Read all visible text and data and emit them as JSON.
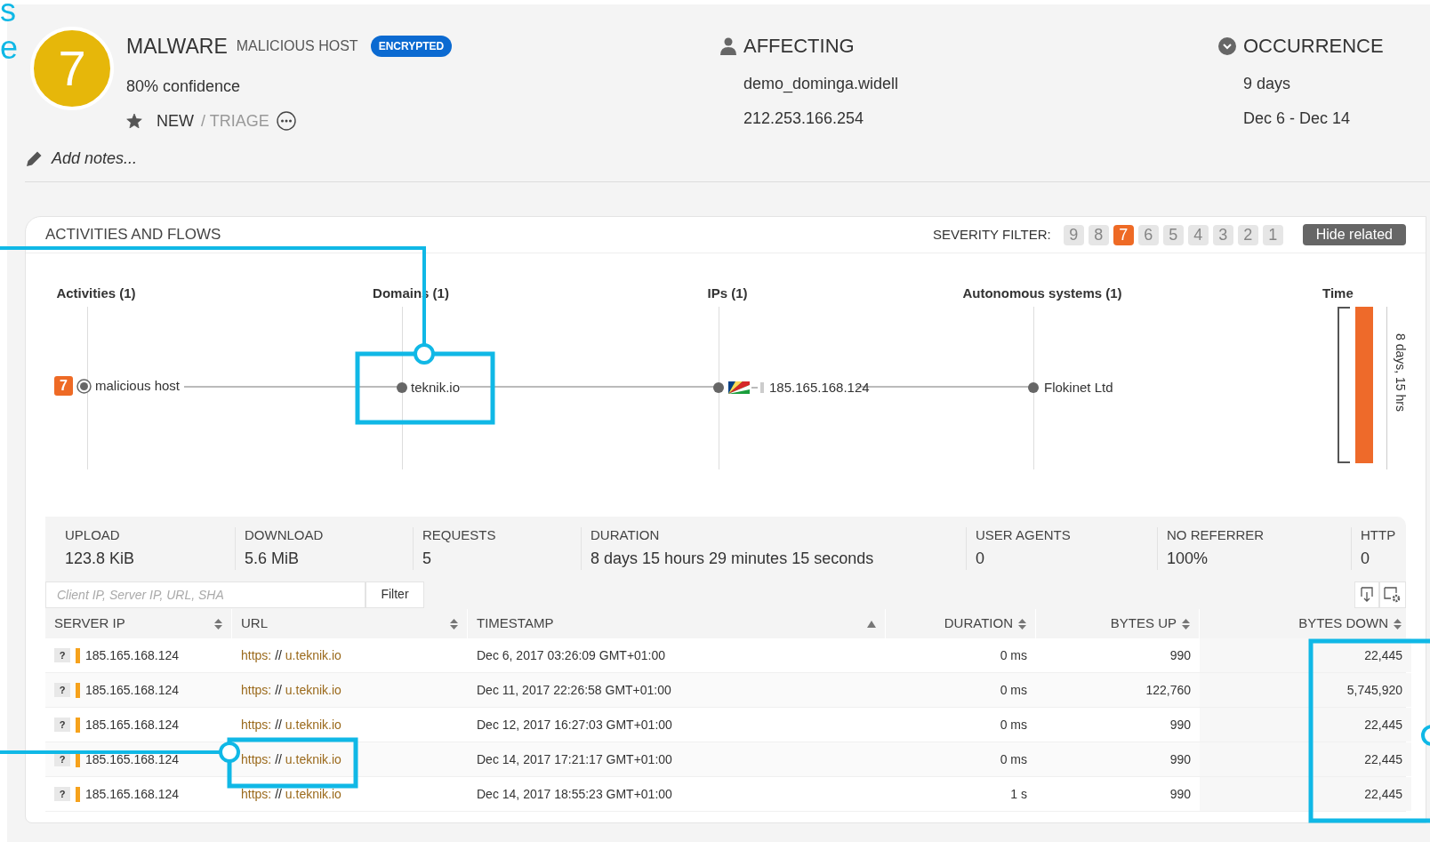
{
  "annotation_fragments": [
    "s",
    "e"
  ],
  "alert": {
    "severity": "7",
    "category": "MALWARE",
    "type": "MALICIOUS HOST",
    "tag": "ENCRYPTED",
    "confidence": "80% confidence",
    "status": "NEW",
    "status_next": "/ TRIAGE",
    "starred": true
  },
  "affecting": {
    "title": "AFFECTING",
    "user": "demo_dominga.widell",
    "ip": "212.253.166.254"
  },
  "occurrence": {
    "title": "OCCURRENCE",
    "duration": "9 days",
    "range": "Dec 6 - Dec 14"
  },
  "notes": {
    "placeholder": "Add notes..."
  },
  "panel": {
    "title": "ACTIVITIES AND FLOWS",
    "severity_filter_label": "SEVERITY FILTER:",
    "severity_levels": [
      {
        "label": "9",
        "selected": false
      },
      {
        "label": "8",
        "selected": false
      },
      {
        "label": "7",
        "selected": true
      },
      {
        "label": "6",
        "selected": false
      },
      {
        "label": "5",
        "selected": false
      },
      {
        "label": "4",
        "selected": false
      },
      {
        "label": "3",
        "selected": false
      },
      {
        "label": "2",
        "selected": false
      },
      {
        "label": "1",
        "selected": false
      }
    ],
    "hide_button": "Hide related",
    "graph": {
      "columns": [
        "Activities (1)",
        "Domains (1)",
        "IPs (1)",
        "Autonomous systems (1)",
        "Time"
      ],
      "activity": {
        "severity": "7",
        "name": "malicious host"
      },
      "domain": "teknik.io",
      "ip": "185.165.168.124",
      "asn": "Flokinet Ltd",
      "time_span": "8 days, 15 hrs"
    },
    "stats": [
      {
        "label": "UPLOAD",
        "value": "123.8 KiB"
      },
      {
        "label": "DOWNLOAD",
        "value": "5.6 MiB"
      },
      {
        "label": "REQUESTS",
        "value": "5"
      },
      {
        "label": "DURATION",
        "value": "8 days 15 hours 29 minutes 15 seconds"
      },
      {
        "label": "USER AGENTS",
        "value": "0"
      },
      {
        "label": "NO REFERRER",
        "value": "100%"
      },
      {
        "label": "HTTP",
        "value": "0"
      }
    ],
    "filter": {
      "placeholder": "Client IP, Server IP, URL, SHA",
      "button": "Filter"
    },
    "table": {
      "columns": [
        {
          "label": "SERVER IP",
          "sorted": false
        },
        {
          "label": "URL",
          "sorted": false
        },
        {
          "label": "TIMESTAMP",
          "sorted": true
        },
        {
          "label": "DURATION",
          "sorted": false
        },
        {
          "label": "BYTES UP",
          "sorted": false
        },
        {
          "label": "BYTES DOWN",
          "sorted": false
        }
      ],
      "rows": [
        {
          "badge": "?",
          "server_ip": "185.165.168.124",
          "url": {
            "scheme": "https:",
            "sep": "//",
            "host": "u.teknik.io"
          },
          "timestamp": "Dec 6, 2017 03:26:09 GMT+01:00",
          "duration": "0 ms",
          "bytes_up": "990",
          "bytes_down": "22,445"
        },
        {
          "badge": "?",
          "server_ip": "185.165.168.124",
          "url": {
            "scheme": "https:",
            "sep": "//",
            "host": "u.teknik.io"
          },
          "timestamp": "Dec 11, 2017 22:26:58 GMT+01:00",
          "duration": "0 ms",
          "bytes_up": "122,760",
          "bytes_down": "5,745,920"
        },
        {
          "badge": "?",
          "server_ip": "185.165.168.124",
          "url": {
            "scheme": "https:",
            "sep": "//",
            "host": "u.teknik.io"
          },
          "timestamp": "Dec 12, 2017 16:27:03 GMT+01:00",
          "duration": "0 ms",
          "bytes_up": "990",
          "bytes_down": "22,445"
        },
        {
          "badge": "?",
          "server_ip": "185.165.168.124",
          "url": {
            "scheme": "https:",
            "sep": "//",
            "host": "u.teknik.io"
          },
          "timestamp": "Dec 14, 2017 17:21:17 GMT+01:00",
          "duration": "0 ms",
          "bytes_up": "990",
          "bytes_down": "22,445"
        },
        {
          "badge": "?",
          "server_ip": "185.165.168.124",
          "url": {
            "scheme": "https:",
            "sep": "//",
            "host": "u.teknik.io"
          },
          "timestamp": "Dec 14, 2017 18:55:23 GMT+01:00",
          "duration": "1 s",
          "bytes_up": "990",
          "bytes_down": "22,445"
        }
      ]
    }
  }
}
